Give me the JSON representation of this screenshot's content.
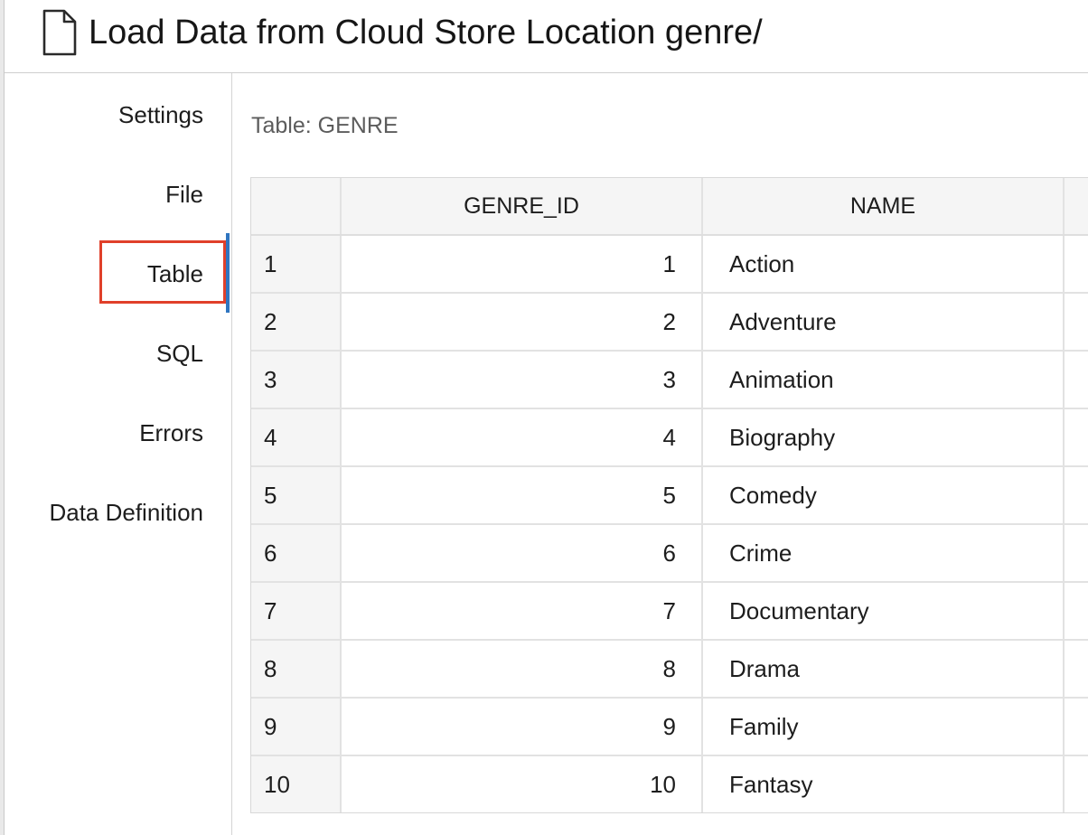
{
  "window": {
    "title": "Load Data from Cloud Store Location genre/",
    "title_icon": "document-icon"
  },
  "sidebar": {
    "items": [
      {
        "label": "Settings",
        "selected": false
      },
      {
        "label": "File",
        "selected": false
      },
      {
        "label": "Table",
        "selected": true
      },
      {
        "label": "SQL",
        "selected": false
      },
      {
        "label": "Errors",
        "selected": false
      },
      {
        "label": "Data Definition",
        "selected": false
      }
    ],
    "highlight_color": "#e0402a",
    "selected_bar_color": "#2f75c0"
  },
  "main": {
    "table_caption": "Table: GENRE",
    "columns": [
      "",
      "GENRE_ID",
      "NAME"
    ],
    "rows": [
      {
        "num": "1",
        "genre_id": "1",
        "name": "Action"
      },
      {
        "num": "2",
        "genre_id": "2",
        "name": "Adventure"
      },
      {
        "num": "3",
        "genre_id": "3",
        "name": "Animation"
      },
      {
        "num": "4",
        "genre_id": "4",
        "name": "Biography"
      },
      {
        "num": "5",
        "genre_id": "5",
        "name": "Comedy"
      },
      {
        "num": "6",
        "genre_id": "6",
        "name": "Crime"
      },
      {
        "num": "7",
        "genre_id": "7",
        "name": "Documentary"
      },
      {
        "num": "8",
        "genre_id": "8",
        "name": "Drama"
      },
      {
        "num": "9",
        "genre_id": "9",
        "name": "Family"
      },
      {
        "num": "10",
        "genre_id": "10",
        "name": "Fantasy"
      }
    ]
  }
}
